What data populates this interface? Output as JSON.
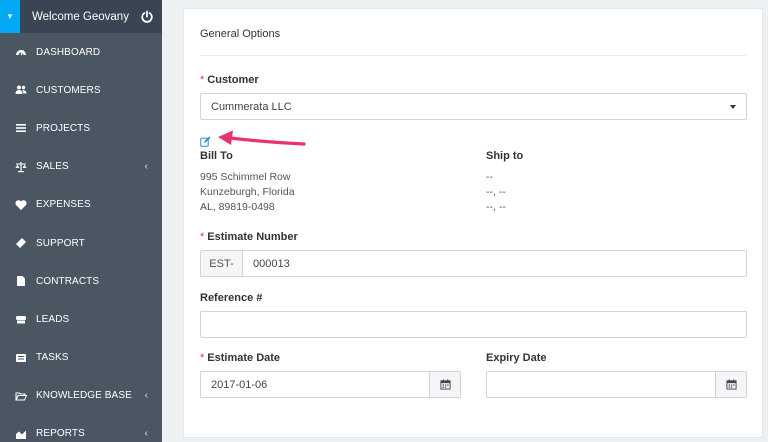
{
  "sidebar": {
    "welcome": "Welcome Geovany",
    "items": [
      {
        "label": "DASHBOARD",
        "icon": "dashboard-icon",
        "chevron": ""
      },
      {
        "label": "CUSTOMERS",
        "icon": "users-icon",
        "chevron": ""
      },
      {
        "label": "PROJECTS",
        "icon": "bars-icon",
        "chevron": ""
      },
      {
        "label": "SALES",
        "icon": "balance-scale-icon",
        "chevron": "‹"
      },
      {
        "label": "EXPENSES",
        "icon": "heartbeat-icon",
        "chevron": ""
      },
      {
        "label": "SUPPORT",
        "icon": "ticket-icon",
        "chevron": ""
      },
      {
        "label": "CONTRACTS",
        "icon": "file-icon",
        "chevron": ""
      },
      {
        "label": "LEADS",
        "icon": "tty-icon",
        "chevron": ""
      },
      {
        "label": "TASKS",
        "icon": "tasks-icon",
        "chevron": ""
      },
      {
        "label": "KNOWLEDGE BASE",
        "icon": "folder-open-icon",
        "chevron": "‹"
      },
      {
        "label": "REPORTS",
        "icon": "area-chart-icon",
        "chevron": "‹"
      }
    ]
  },
  "form": {
    "section_title": "General Options",
    "required_mark": "*",
    "customer_label": "Customer",
    "customer_value": "Cummerata LLC",
    "bill_to_label": "Bill To",
    "bill_to_lines": [
      "995 Schimmel Row",
      "Kunzeburgh, Florida",
      "AL, 89819-0498"
    ],
    "ship_to_label": "Ship to",
    "ship_to_lines": [
      "--",
      "--, --",
      "--, --"
    ],
    "estimate_number_label": "Estimate Number",
    "estimate_prefix": "EST-",
    "estimate_number_value": "000013",
    "reference_label": "Reference #",
    "reference_value": "",
    "estimate_date_label": "Estimate Date",
    "estimate_date_value": "2017-01-06",
    "expiry_date_label": "Expiry Date",
    "expiry_date_value": ""
  },
  "colors": {
    "sidebar_bg": "#4b5663",
    "welcome_bg": "#3a4452",
    "toggle_accent": "#03a9f4",
    "edit_icon": "#2c8fd8",
    "annotation_arrow": "#e8336b",
    "required": "#e63939"
  }
}
